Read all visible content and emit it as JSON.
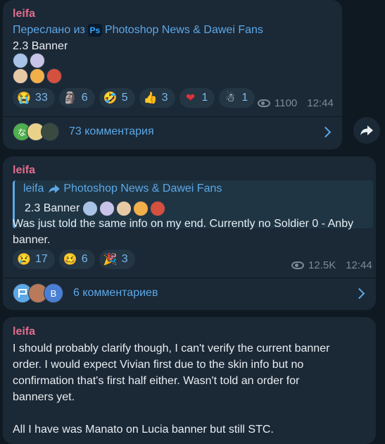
{
  "messages": [
    {
      "author": "leifa",
      "forwarded_prefix": "Переслано из",
      "forwarded_channel": "Photoshop News & Dawei Fans",
      "text": "2.3 Banner",
      "reactions": [
        {
          "icon": "crying-face-icon",
          "glyph": "😭",
          "count": "33"
        },
        {
          "icon": "moai-icon",
          "glyph": "🗿",
          "count": "6"
        },
        {
          "icon": "rofl-face-icon",
          "glyph": "🤣",
          "count": "5"
        },
        {
          "icon": "thumbs-up-icon",
          "glyph": "👍",
          "count": "3"
        },
        {
          "icon": "heart-icon",
          "glyph": "❤",
          "count": "1"
        },
        {
          "icon": "snowman-icon",
          "glyph": "☃",
          "count": "1"
        }
      ],
      "views": "1100",
      "time": "12:44",
      "comments_label": "73 комментария"
    },
    {
      "author": "leifa",
      "quote_author": "leifa",
      "quote_channel": "Photoshop News & Dawei Fans",
      "quote_text": "2.3 Banner",
      "text": "Was just told the same info on my end. Currently no Soldier 0 - Anby banner.",
      "reactions": [
        {
          "icon": "sad-face-icon",
          "glyph": "😢",
          "count": "17"
        },
        {
          "icon": "woozy-face-icon",
          "glyph": "🥴",
          "count": "6"
        },
        {
          "icon": "party-popper-icon",
          "glyph": "🎉",
          "count": "3"
        }
      ],
      "views": "12.5K",
      "time": "12:44",
      "comments_label": "6 комментариев",
      "commenter_badge": "B"
    },
    {
      "author": "leifa",
      "text_line1": "I should probably clarify though, I can't verify the current banner",
      "text_line2": "order. I would expect Vivian first due to the skin info but no",
      "text_line3": "confirmation that's first half either. Wasn't told an order for",
      "text_line4": "banners yet.",
      "text_line5": "All I have was Manato on Lucia banner but still STC."
    }
  ],
  "commenter_badge_1": "な",
  "colors": {
    "accent": "#5ca8e6",
    "author": "#e06d8c",
    "bubble": "#1b2836",
    "bg": "#0f1922"
  }
}
